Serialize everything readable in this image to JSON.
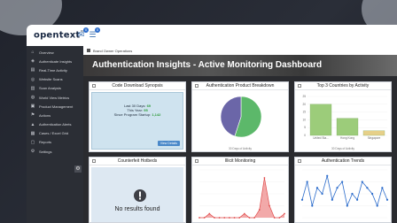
{
  "app": {
    "logo": "opentext",
    "logo_tm": "™"
  },
  "topbar_icons": [
    {
      "name": "notification-icon",
      "badge": "0"
    },
    {
      "name": "message-icon",
      "badge": "0"
    }
  ],
  "sidebar": {
    "items": [
      {
        "label": "Overview",
        "icon": "home-icon"
      },
      {
        "label": "Authenticate Insights",
        "icon": "shield-icon"
      },
      {
        "label": "Real-Time Activity",
        "icon": "chart-icon"
      },
      {
        "label": "Website Scans",
        "icon": "scan-icon"
      },
      {
        "label": "Scan Analysis",
        "icon": "analysis-icon"
      },
      {
        "label": "World View Metrics",
        "icon": "globe-icon"
      },
      {
        "label": "Product Management",
        "icon": "box-icon"
      },
      {
        "label": "Actions",
        "icon": "flag-icon"
      },
      {
        "label": "Authentication Alerts",
        "icon": "alert-icon"
      },
      {
        "label": "Cases / Excel Grid",
        "icon": "grid-icon"
      },
      {
        "label": "Reports",
        "icon": "report-icon"
      },
      {
        "label": "Settings",
        "icon": "gear-icon"
      }
    ]
  },
  "breadcrumb": "Brand Owner Operations",
  "banner": {
    "title": "Authentication Insights - Active Monitoring Dashboard"
  },
  "cards": {
    "synopsis": {
      "title": "Code Download Synopsis",
      "lines": [
        {
          "label": "Last 30 Days:",
          "value": "69"
        },
        {
          "label": "This Year:",
          "value": "95"
        },
        {
          "label": "Since Program Startup:",
          "value": "1,142"
        }
      ],
      "button": "View Details"
    },
    "breakdown": {
      "title": "Authentication Product Breakdown",
      "footer": "30 Days of Activity"
    },
    "countries": {
      "title": "Top 3 Countries by Activity",
      "footer": "30 Days of Activity"
    },
    "hotbeds": {
      "title": "Counterfeit Hotbeds",
      "empty": "No results found"
    },
    "illicit": {
      "title": "Illicit Monitoring"
    },
    "trends": {
      "title": "Authentication Trends"
    }
  },
  "chart_data": [
    {
      "type": "pie",
      "title": "Authentication Product Breakdown",
      "slices": [
        {
          "name": "",
          "value": 55,
          "color": "#5cb86a"
        },
        {
          "name": "",
          "value": 45,
          "color": "#6b66a8"
        }
      ]
    },
    {
      "type": "bar",
      "title": "Top 3 Countries by Activity",
      "categories": [
        "United Sta...",
        "Hong Kong",
        "Singapore"
      ],
      "values": [
        20,
        11,
        3
      ],
      "ylim": [
        0,
        25
      ],
      "yticks": [
        "0",
        "5",
        "10",
        "15",
        "20",
        "25"
      ],
      "colors": [
        "#9ccc7a",
        "#9ccc7a",
        "#e6d089"
      ]
    },
    {
      "type": "area",
      "title": "Illicit Monitoring",
      "values": [
        0,
        0,
        1,
        0,
        0,
        0,
        0,
        0,
        0,
        1,
        0,
        0,
        2,
        10,
        3,
        0,
        0,
        1
      ],
      "ylim": [
        0,
        12
      ],
      "color": "#e04a4a"
    },
    {
      "type": "line",
      "title": "Authentication Trends",
      "values": [
        3,
        6,
        2,
        5,
        4,
        7,
        3,
        5,
        6,
        2,
        4,
        3,
        6,
        5,
        4,
        2,
        5,
        3
      ],
      "ylim": [
        0,
        8
      ],
      "color": "#2d6dcc"
    }
  ]
}
